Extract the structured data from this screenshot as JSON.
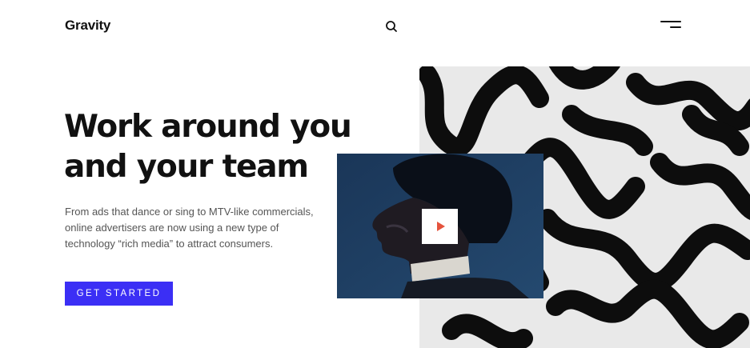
{
  "header": {
    "logo": "Gravity",
    "search_icon": "search-icon",
    "menu_icon": "menu-icon"
  },
  "hero": {
    "headline_lines": [
      "Work around you",
      "and your team"
    ],
    "description_lines": [
      "From ads that dance or sing to MTV-like commercials,",
      "online advertisers are now using a new type of",
      "technology “rich media” to attract consumers."
    ],
    "cta_label": "GET STARTED"
  },
  "media": {
    "artwork": "abstract black brush-stroke pattern",
    "video_icon": "play-icon"
  },
  "colors": {
    "accent": "#3b2ff5",
    "play": "#e5533d",
    "video_bg": "#1d3a5a",
    "text": "#111111",
    "muted": "#555555"
  }
}
